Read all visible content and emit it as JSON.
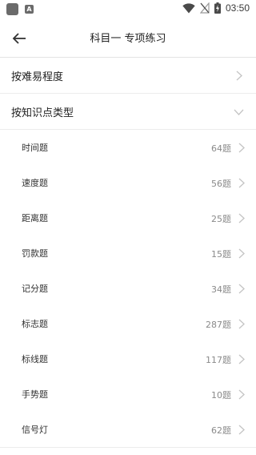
{
  "status_bar": {
    "time": "03:50",
    "icons": [
      "app-icon",
      "a-badge-icon",
      "wifi-icon",
      "no-sim-icon",
      "battery-charging-icon"
    ],
    "a_label": "A"
  },
  "header": {
    "title": "科目一 专项练习",
    "back_icon": "back-arrow-icon"
  },
  "sections": [
    {
      "label": "按难易程度",
      "state": "collapsed",
      "icon": "chevron-right-icon"
    },
    {
      "label": "按知识点类型",
      "state": "expanded",
      "icon": "chevron-down-icon"
    }
  ],
  "knowledge_items": [
    {
      "label": "时间题",
      "count": "64题"
    },
    {
      "label": "速度题",
      "count": "56题"
    },
    {
      "label": "距离题",
      "count": "25题"
    },
    {
      "label": "罚款题",
      "count": "15题"
    },
    {
      "label": "记分题",
      "count": "34题"
    },
    {
      "label": "标志题",
      "count": "287题"
    },
    {
      "label": "标线题",
      "count": "117题"
    },
    {
      "label": "手势题",
      "count": "10题"
    },
    {
      "label": "信号灯",
      "count": "62题"
    }
  ],
  "colors": {
    "text": "#212121",
    "muted": "#8a8a8a",
    "chevron": "#c4c4c4",
    "divider": "#ececec"
  }
}
